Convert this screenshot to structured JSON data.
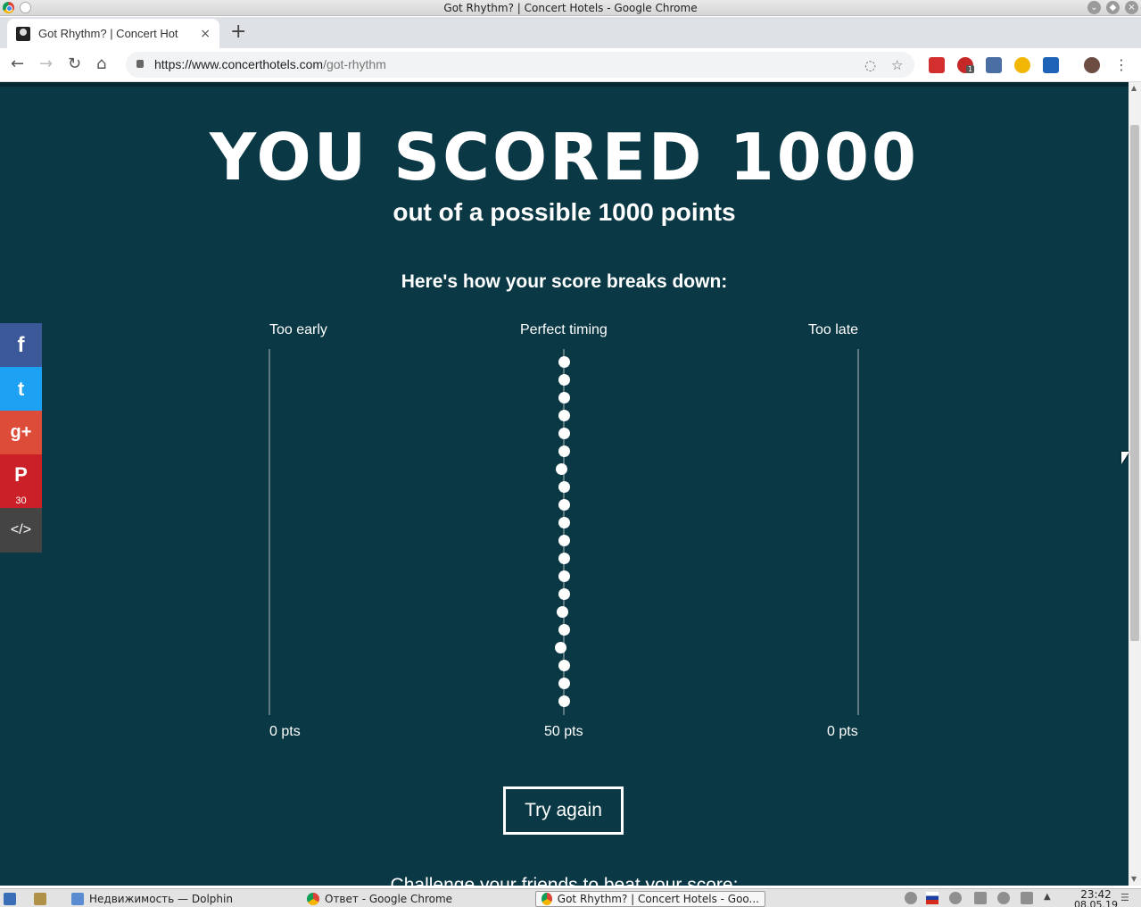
{
  "window": {
    "title": "Got Rhythm? | Concert Hotels - Google Chrome",
    "controls": [
      "minimize",
      "maximize",
      "close"
    ]
  },
  "browser": {
    "tab_title": "Got Rhythm? | Concert Hot",
    "tab_close": "×",
    "new_tab": "+",
    "url_host": "https://www.concerthotels.com",
    "url_path": "/got-rhythm",
    "extension_badge": "1"
  },
  "page": {
    "headline": "YOU SCORED 1000",
    "subhead": "out of a possible 1000 points",
    "breakdown_title": "Here's how your score breaks down:",
    "columns": {
      "early_label": "Too early",
      "perfect_label": "Perfect timing",
      "late_label": "Too late",
      "early_pts": "0 pts",
      "perfect_pts": "50 pts",
      "late_pts": "0 pts"
    },
    "timing_dots_offsets": [
      0,
      0,
      0,
      0,
      0,
      0,
      -3,
      0,
      0,
      0,
      0,
      0,
      0,
      0,
      -2,
      0,
      -4,
      0,
      0,
      0
    ],
    "try_again_label": "Try again",
    "challenge_text": "Challenge your friends to beat your score:",
    "colors": {
      "background": "#0b3845",
      "text": "#ffffff"
    }
  },
  "share": {
    "facebook": {
      "icon": "facebook-icon",
      "glyph": "f",
      "color": "#3b5998"
    },
    "twitter": {
      "icon": "twitter-icon",
      "glyph": "t",
      "color": "#1da1f2"
    },
    "googleplus": {
      "icon": "google-plus-icon",
      "glyph": "g+",
      "color": "#dd4b39"
    },
    "pinterest": {
      "icon": "pinterest-icon",
      "glyph": "P",
      "count": "30",
      "color": "#cb2027"
    },
    "embed": {
      "icon": "embed-code-icon",
      "glyph": "</>",
      "color": "#444444"
    }
  },
  "taskbar": {
    "items": [
      {
        "label": "Недвижимость — Dolphin"
      },
      {
        "label": "Ответ - Google Chrome"
      },
      {
        "label": "Got Rhythm? | Concert Hotels - Goo..."
      }
    ],
    "clock_time": "23:42",
    "clock_date": "08.05.19"
  }
}
